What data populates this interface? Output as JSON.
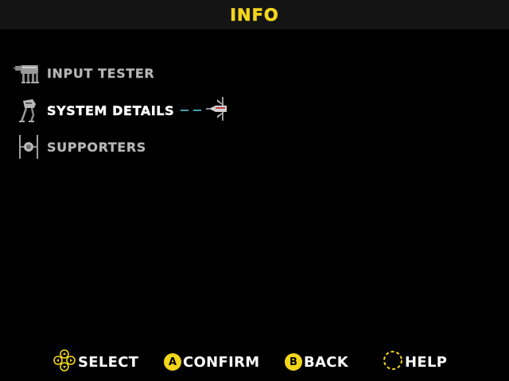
{
  "header": {
    "title": "INFO"
  },
  "menu": {
    "items": [
      {
        "label": "INPUT TESTER",
        "icon": "at-at-walker-icon",
        "selected": false
      },
      {
        "label": "SYSTEM DETAILS",
        "icon": "at-st-walker-icon",
        "selected": true
      },
      {
        "label": "SUPPORTERS",
        "icon": "tie-fighter-icon",
        "selected": false
      }
    ],
    "selector_icon": "x-wing-icon"
  },
  "footer": {
    "select_label": "SELECT",
    "select_icon": "dpad-icon",
    "confirm_label": "CONFIRM",
    "confirm_button": "A",
    "back_label": "BACK",
    "back_button": "B",
    "help_label": "HELP",
    "help_icon": "dashed-circle-icon"
  },
  "colors": {
    "accent": "#f2d61c",
    "header_bg": "#141414",
    "background": "#000000",
    "item_inactive": "#b8b8b8",
    "item_active": "#ffffff",
    "laser": "#3fa0b0"
  }
}
